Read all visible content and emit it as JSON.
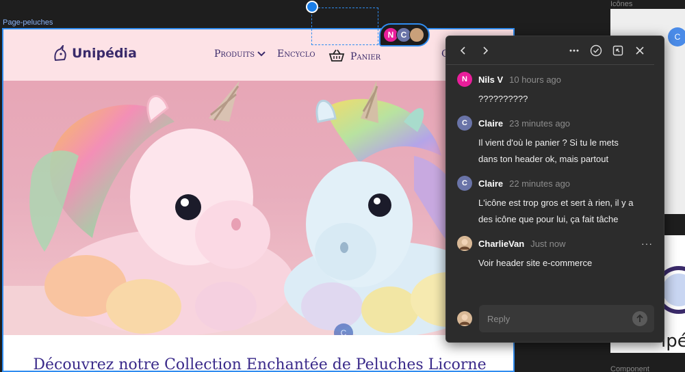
{
  "canvas": {
    "frame_label": "Page-peluches",
    "side_label_top": "Icônes",
    "side_label_bottom": "Component",
    "side_pin_initial": "C",
    "side_logo_fragment": "ipé"
  },
  "site": {
    "logo_text": "Unipédia",
    "nav": {
      "products": "Produits",
      "encyclo": "Encyclo",
      "panier": "Panier",
      "overflow": "C"
    },
    "pin_cluster": [
      {
        "initial": "N",
        "color": "#e91e9b"
      },
      {
        "initial": "C",
        "color": "#6a74a8"
      },
      {
        "initial": "",
        "color": "#c9a07a"
      }
    ],
    "hero_pin_initial": "C",
    "collection_title": "Découvrez notre Collection Enchantée de Peluches Licorne"
  },
  "colors": {
    "accent": "#2f8cf0",
    "header_bg": "#fde2e6",
    "panel_bg": "#2c2c2c"
  },
  "panel": {
    "toolbar": {
      "prev_icon": "chevron-left-icon",
      "next_icon": "chevron-right-icon",
      "more_icon": "more-icon",
      "resolve_icon": "check-circle-icon",
      "open_icon": "open-external-icon",
      "close_icon": "close-icon"
    },
    "comments": [
      {
        "initial": "N",
        "color": "#e91e9b",
        "author": "Nils V",
        "time": "10 hours ago",
        "body": "??????????"
      },
      {
        "initial": "C",
        "color": "#6a74a8",
        "author": "Claire",
        "time": "23 minutes ago",
        "body": "Il vient d'où le panier ? Si tu le mets dans ton header ok, mais partout"
      },
      {
        "initial": "C",
        "color": "#6a74a8",
        "author": "Claire",
        "time": "22 minutes ago",
        "body": "L'icône est trop gros et sert à rien, il y a des icône que pour lui, ça fait tâche"
      },
      {
        "initial": "",
        "color": "#c9a07a",
        "author": "CharlieVan",
        "time": "Just now",
        "body": "Voir header site e-commerce"
      }
    ],
    "reply_placeholder": "Reply"
  }
}
